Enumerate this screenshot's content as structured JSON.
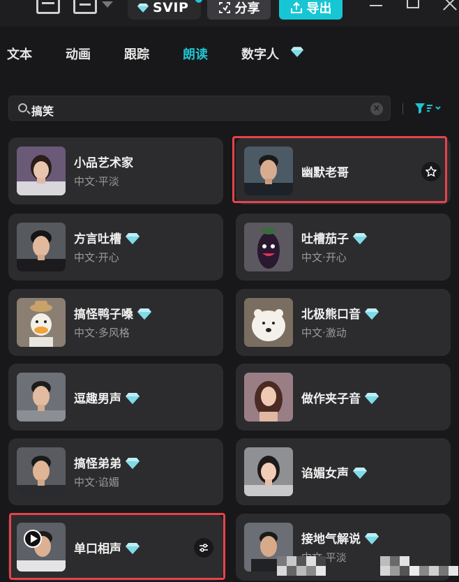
{
  "topbar": {
    "svip_label": "SVIP",
    "share_label": "分享",
    "export_label": "导出",
    "accent": "#17c6d5"
  },
  "tabs": [
    {
      "label": "文本",
      "active": false
    },
    {
      "label": "动画",
      "active": false
    },
    {
      "label": "跟踪",
      "active": false
    },
    {
      "label": "朗读",
      "active": true
    },
    {
      "label": "数字人",
      "active": false,
      "vip": true
    }
  ],
  "search": {
    "value": "搞笑",
    "placeholder": ""
  },
  "voices": [
    {
      "name": "小品艺术家",
      "desc": "中文·平淡",
      "vip": false,
      "avatar": "woman-smile"
    },
    {
      "name": "幽默老哥",
      "desc": "",
      "vip": false,
      "avatar": "man-black-shirt",
      "highlighted": true,
      "action_icon": "star-icon"
    },
    {
      "name": "方言吐槽",
      "desc": "中文·开心",
      "vip": true,
      "avatar": "young-man"
    },
    {
      "name": "吐槽茄子",
      "desc": "中文·开心",
      "vip": true,
      "avatar": "eggplant"
    },
    {
      "name": "搞怪鸭子嗓",
      "desc": "中文·多风格",
      "vip": true,
      "avatar": "duck"
    },
    {
      "name": "北极熊口音",
      "desc": "中文·激动",
      "vip": true,
      "avatar": "polar-bear"
    },
    {
      "name": "逗趣男声",
      "desc": "",
      "vip": true,
      "avatar": "man-smile"
    },
    {
      "name": "做作夹子音",
      "desc": "",
      "vip": true,
      "avatar": "woman-curly"
    },
    {
      "name": "搞怪弟弟",
      "desc": "中文·谄媚",
      "vip": true,
      "avatar": "boy"
    },
    {
      "name": "谄媚女声",
      "desc": "",
      "vip": true,
      "avatar": "woman-grey"
    },
    {
      "name": "单口相声",
      "desc": "",
      "vip": true,
      "avatar": "man-play",
      "highlighted": true,
      "action_icon": "settings-sliders-icon"
    },
    {
      "name": "接地气解说",
      "desc": "中文·平淡",
      "vip": true,
      "avatar": "man-suit"
    }
  ]
}
